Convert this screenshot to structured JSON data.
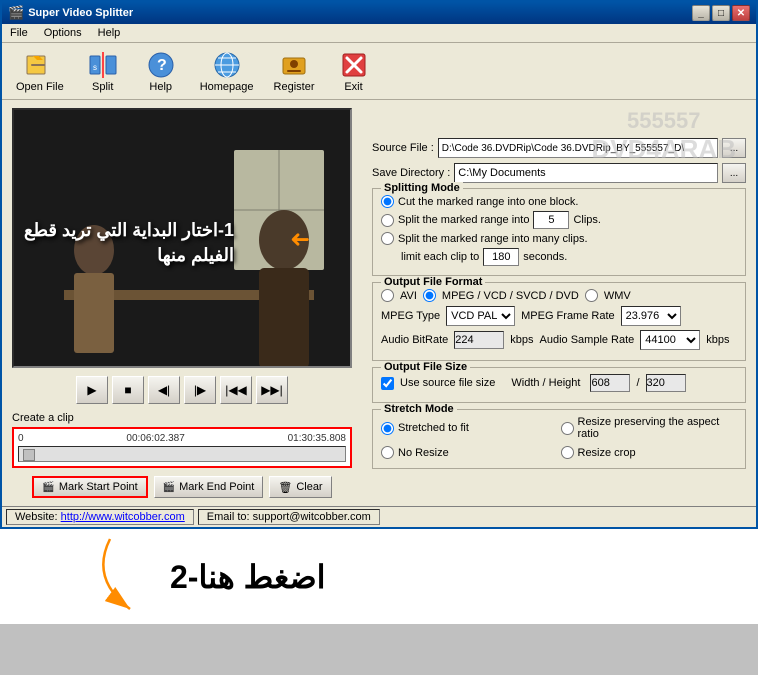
{
  "window": {
    "title": "Super Video Splitter",
    "icon": "video-icon"
  },
  "menu": {
    "items": [
      "File",
      "Options",
      "Help"
    ]
  },
  "toolbar": {
    "buttons": [
      {
        "label": "Open File",
        "icon": "open-file-icon"
      },
      {
        "label": "Split",
        "icon": "split-icon"
      },
      {
        "label": "Help",
        "icon": "help-icon"
      },
      {
        "label": "Homepage",
        "icon": "homepage-icon"
      },
      {
        "label": "Register",
        "icon": "register-icon"
      },
      {
        "label": "Exit",
        "icon": "exit-icon"
      }
    ]
  },
  "video": {
    "arabic_line1": "1-اختار البداية التي تريد قطع",
    "arabic_line2": "الفيلم منها"
  },
  "timeline": {
    "start": "0",
    "current": "00:06:02.387",
    "end": "01:30:35.808"
  },
  "buttons": {
    "mark_start": "Mark Start Point",
    "mark_end": "Mark End Point",
    "clear": "Clear"
  },
  "source": {
    "label": "Source File :",
    "value": "D:\\Code 36.DVDRip\\Code 36.DVDRip_BY_555557_D\\"
  },
  "save": {
    "label": "Save Directory :",
    "value": "C:\\My Documents"
  },
  "splitting_mode": {
    "title": "Splitting Mode",
    "option1": "Cut the marked range into one block.",
    "option2": "Split the marked range into",
    "clips_value": "5",
    "clips_label": "Clips.",
    "option3": "Split the marked range into many clips.",
    "limit_label": "limit each clip to",
    "seconds_value": "180",
    "seconds_label": "seconds."
  },
  "output_format": {
    "title": "Output File Format",
    "avi_label": "AVI",
    "mpeg_label": "MPEG / VCD / SVCD / DVD",
    "wmv_label": "WMV",
    "mpeg_type_label": "MPEG Type",
    "mpeg_type_value": "VCD PAL",
    "frame_rate_label": "MPEG Frame Rate",
    "frame_rate_value": "23.976",
    "audio_bitrate_label": "Audio BitRate",
    "audio_bitrate_value": "224",
    "audio_bitrate_unit": "kbps",
    "audio_sample_label": "Audio Sample Rate",
    "audio_sample_value": "44100",
    "audio_sample_unit": "kbps"
  },
  "output_size": {
    "title": "Output File Size",
    "use_source_label": "Use source file size",
    "width_label": "Width / Height",
    "width_value": "608",
    "height_value": "320"
  },
  "stretch_mode": {
    "title": "Stretch Mode",
    "option1": "Stretched to fit",
    "option2": "Resize preserving the aspect ratio",
    "option3": "No Resize",
    "option4": "Resize crop"
  },
  "status_bar": {
    "website_label": "Website:",
    "website_url": "http://www.witcobber.com",
    "email_label": "Email to: support@witcobber.com"
  },
  "watermark": {
    "line1": "555557",
    "line2": "DVD4ARAB"
  },
  "bottom_annotation": {
    "arabic": "اضغط هنا-2"
  }
}
